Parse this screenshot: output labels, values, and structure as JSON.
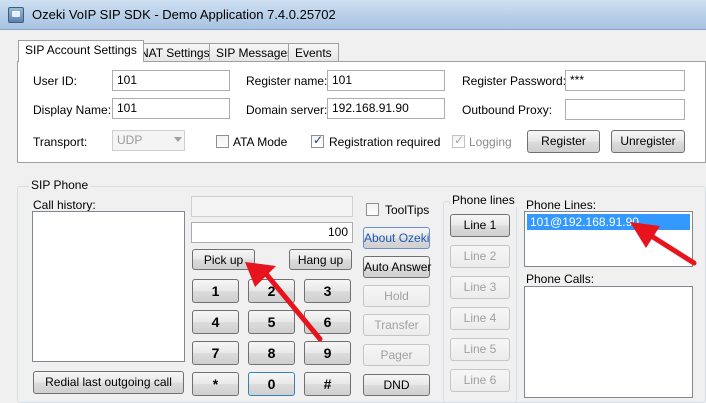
{
  "window": {
    "title": "Ozeki VoIP SIP SDK - Demo Application 7.4.0.25702",
    "accent_color": "#3399ff",
    "annotation_arrow_color": "#e8141d"
  },
  "tabs": [
    {
      "label": "SIP Account Settings",
      "active": true
    },
    {
      "label": "NAT Settings",
      "active": false
    },
    {
      "label": "SIP Messages",
      "active": false
    },
    {
      "label": "Events",
      "active": false
    }
  ],
  "account": {
    "user_id_label": "User ID:",
    "user_id_value": "101",
    "register_name_label": "Register name:",
    "register_name_value": "101",
    "register_password_label": "Register Password:",
    "register_password_value": "***",
    "display_name_label": "Display Name:",
    "display_name_value": "101",
    "domain_server_label": "Domain server:",
    "domain_server_value": "192.168.91.90",
    "outbound_proxy_label": "Outbound Proxy:",
    "outbound_proxy_value": "",
    "transport_label": "Transport:",
    "transport_value": "UDP",
    "ata_mode_label": "ATA Mode",
    "ata_mode_checked": false,
    "registration_required_label": "Registration required",
    "registration_required_checked": true,
    "logging_label": "Logging",
    "logging_checked": true,
    "register_button": "Register",
    "unregister_button": "Unregister"
  },
  "sip_phone": {
    "group_title": "SIP Phone",
    "call_history_label": "Call history:",
    "dial_display_value": "",
    "volume_value": "100",
    "pick_up_button": "Pick up",
    "hang_up_button": "Hang up",
    "keypad": [
      "1",
      "2",
      "3",
      "4",
      "5",
      "6",
      "7",
      "8",
      "9",
      "*",
      "0",
      "#"
    ],
    "redial_button": "Redial last outgoing call",
    "tooltips_label": "ToolTips",
    "tooltips_checked": false,
    "about_button": "About Ozeki",
    "auto_answer_button": "Auto Answer",
    "hold_button": "Hold",
    "transfer_button": "Transfer",
    "pager_button": "Pager",
    "dnd_button": "DND",
    "phone_lines_group_title": "Phone lines",
    "lines": [
      "Line 1",
      "Line 2",
      "Line 3",
      "Line 4",
      "Line 5",
      "Line 6"
    ],
    "phone_lines_list_label": "Phone Lines:",
    "phone_lines_items": [
      "101@192.168.91.90"
    ],
    "phone_calls_label": "Phone Calls:"
  }
}
